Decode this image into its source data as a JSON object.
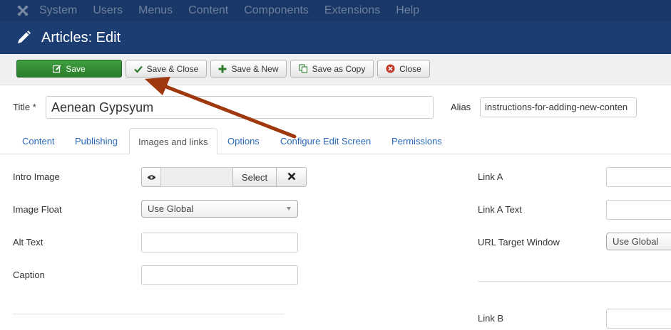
{
  "nav": {
    "items": [
      "System",
      "Users",
      "Menus",
      "Content",
      "Components",
      "Extensions",
      "Help"
    ]
  },
  "header": {
    "title": "Articles: Edit"
  },
  "toolbar": {
    "save": "Save",
    "save_close": "Save & Close",
    "save_new": "Save & New",
    "save_copy": "Save as Copy",
    "close": "Close"
  },
  "title_row": {
    "title_label": "Title *",
    "title_value": "Aenean Gypsyum",
    "alias_label": "Alias",
    "alias_value": "instructions-for-adding-new-conten"
  },
  "tabs": [
    "Content",
    "Publishing",
    "Images and links",
    "Options",
    "Configure Edit Screen",
    "Permissions"
  ],
  "active_tab": "Images and links",
  "images": {
    "intro_image_label": "Intro Image",
    "select_label": "Select",
    "image_float_label": "Image Float",
    "image_float_value": "Use Global",
    "alt_text_label": "Alt Text",
    "caption_label": "Caption"
  },
  "links": {
    "link_a_label": "Link A",
    "link_a_text_label": "Link A Text",
    "url_target_label": "URL Target Window",
    "url_target_value": "Use Global",
    "link_b_label": "Link B"
  },
  "colors": {
    "topnav_bg": "#1a3867",
    "header_bg": "#1c3d72",
    "save_green": "#2f8a2f",
    "link_blue": "#2a69b8",
    "arrow_color": "#a0380f"
  },
  "icons": {
    "logo": "joomla-logo-icon",
    "header": "pencil-icon",
    "save": "edit-icon",
    "save_close": "check-icon",
    "save_new": "plus-icon",
    "save_copy": "copy-icon",
    "close": "close-circle-icon",
    "preview": "eye-icon",
    "clear": "x-icon"
  }
}
